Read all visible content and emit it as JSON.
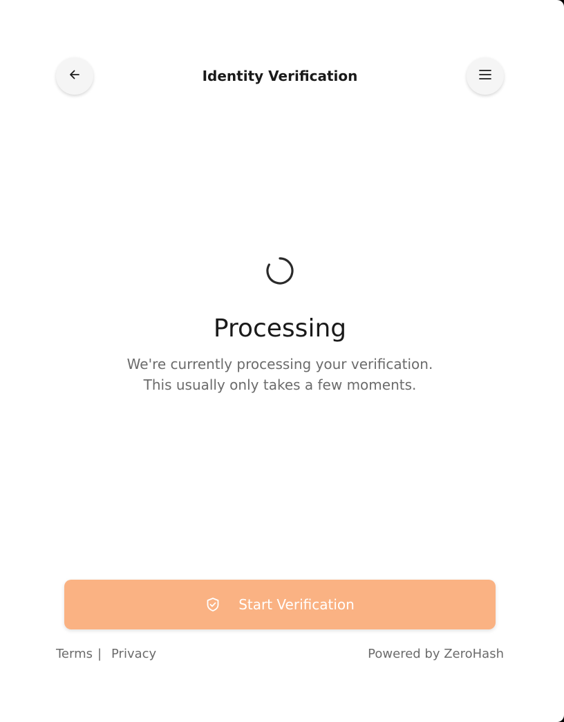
{
  "header": {
    "title": "Identity Verification",
    "back_icon": "arrow-left-icon",
    "menu_icon": "hamburger-menu-icon"
  },
  "status": {
    "spinner_icon": "loading-spinner-icon",
    "title": "Processing",
    "line1": "We're currently processing your verification.",
    "line2": "This usually only takes a few moments."
  },
  "action": {
    "label": "Start Verification",
    "icon": "shield-check-icon",
    "color": "#fab283"
  },
  "footer": {
    "terms": "Terms",
    "separator": "|",
    "privacy": "Privacy",
    "powered_by": "Powered by ZeroHash"
  }
}
